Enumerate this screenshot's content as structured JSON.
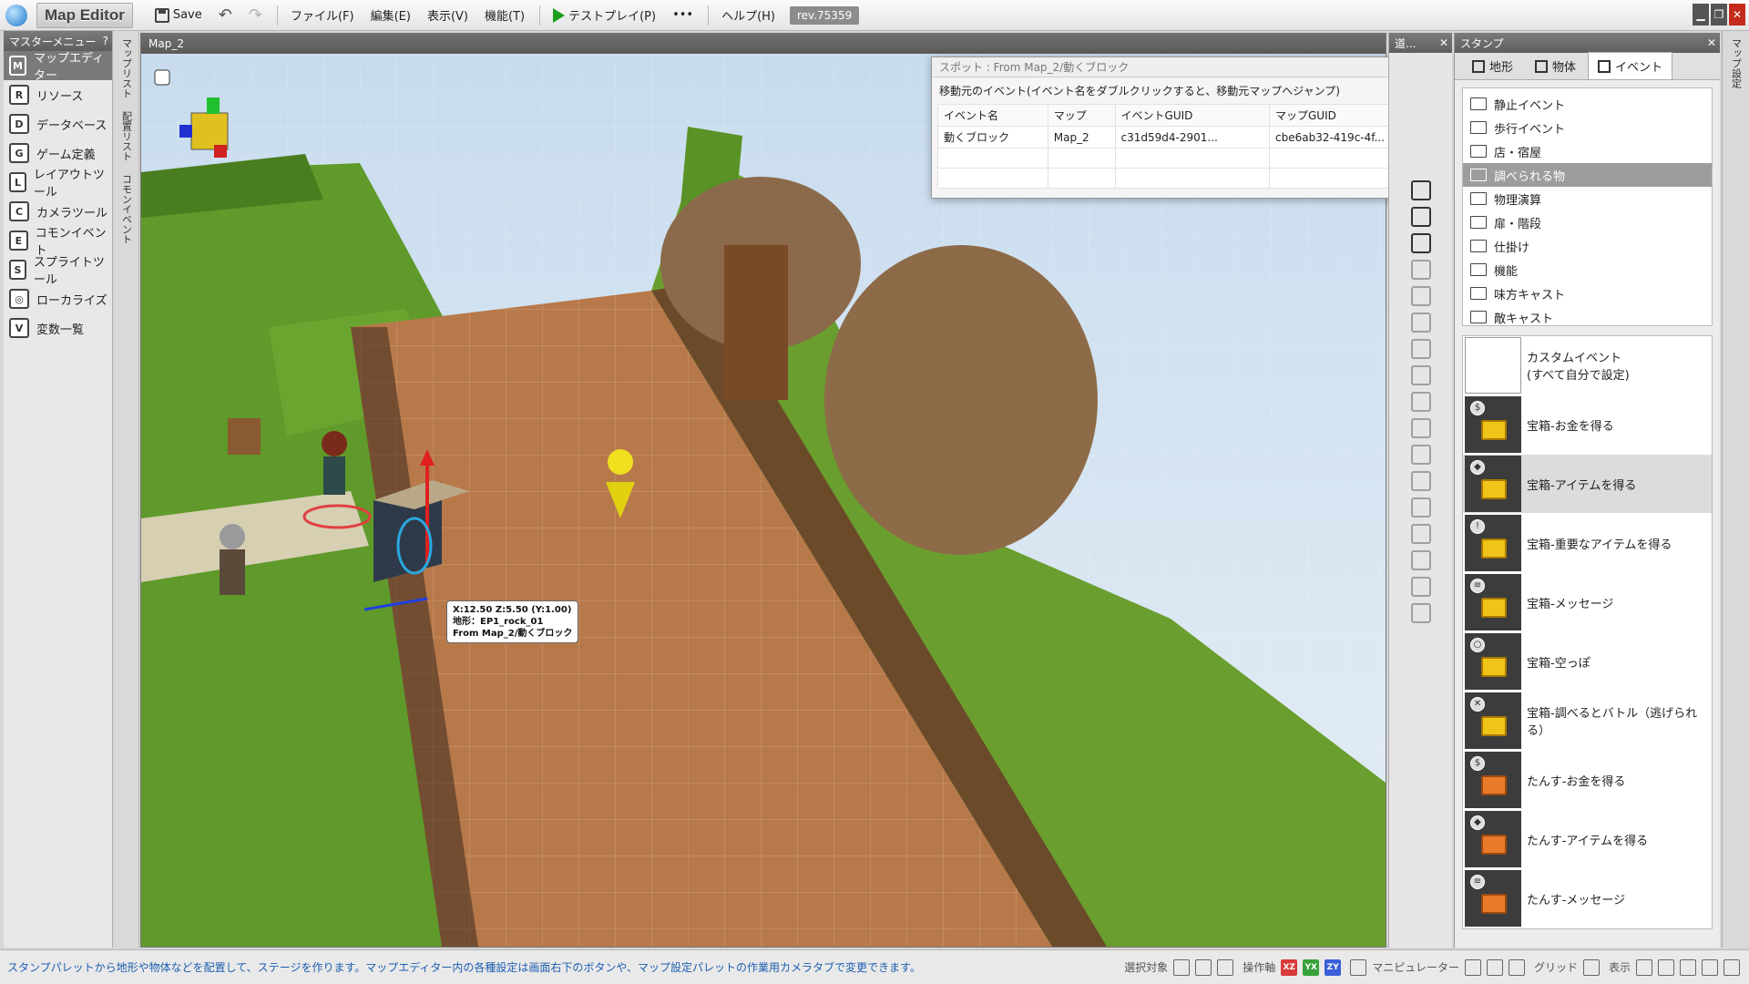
{
  "app": {
    "title": "Map Editor",
    "save_label": "Save",
    "menus": [
      "ファイル(F)",
      "編集(E)",
      "表示(V)",
      "機能(T)"
    ],
    "testplay_label": "テストプレイ(P)",
    "more_label": "•••",
    "help_label": "ヘルプ(H)",
    "revision": "rev.75359"
  },
  "master_menu": {
    "title": "マスターメニュー",
    "help": "?",
    "items": [
      {
        "label": "マップエディター",
        "icon": "map-editor-icon",
        "glyph": "M"
      },
      {
        "label": "リソース",
        "icon": "resource-icon",
        "glyph": "R"
      },
      {
        "label": "データベース",
        "icon": "database-icon",
        "glyph": "D"
      },
      {
        "label": "ゲーム定義",
        "icon": "game-definition-icon",
        "glyph": "G"
      },
      {
        "label": "レイアウトツール",
        "icon": "layout-tool-icon",
        "glyph": "L"
      },
      {
        "label": "カメラツール",
        "icon": "camera-tool-icon",
        "glyph": "C"
      },
      {
        "label": "コモンイベント",
        "icon": "common-event-icon",
        "glyph": "E"
      },
      {
        "label": "スプライトツール",
        "icon": "sprite-tool-icon",
        "glyph": "S"
      },
      {
        "label": "ローカライズ",
        "icon": "localize-icon",
        "glyph": "◎"
      },
      {
        "label": "変数一覧",
        "icon": "variable-list-icon",
        "glyph": "V"
      }
    ]
  },
  "side_tabs": {
    "left": [
      "マップリスト",
      "配置リスト",
      "コモンイベント"
    ],
    "right": [
      "マップ設定"
    ]
  },
  "viewport": {
    "title": "Map_2",
    "tooltip": [
      "X:12.50 Z:5.50 (Y:1.00)",
      "地形：EP1_rock_01",
      "From Map_2/動くブロック"
    ]
  },
  "spot_dialog": {
    "title": "スポット : From Map_2/動くブロック",
    "message": "移動元のイベント(イベント名をダブルクリックすると、移動元マップへジャンプ)",
    "columns": [
      "イベント名",
      "マップ",
      "イベントGUID",
      "マップGUID"
    ],
    "rows": [
      [
        "動くブロック",
        "Map_2",
        "c31d59d4-2901...",
        "cbe6ab32-419c-4f..."
      ]
    ]
  },
  "tool_column": {
    "title": "道..."
  },
  "stamp": {
    "title": "スタンプ",
    "tabs": [
      "地形",
      "物体",
      "イベント"
    ],
    "folders": [
      "静止イベント",
      "歩行イベント",
      "店・宿屋",
      "調べられる物",
      "物理演算",
      "扉・階段",
      "仕掛け",
      "機能",
      "味方キャスト",
      "敵キャスト"
    ],
    "selected_folder": 3,
    "events": [
      {
        "label": "カスタムイベント\n(すべて自分で設定)",
        "kind": "custom"
      },
      {
        "label": "宝箱-お金を得る",
        "kind": "chest",
        "badge": "$"
      },
      {
        "label": "宝箱-アイテムを得る",
        "kind": "chest",
        "badge": "◆",
        "selected": true
      },
      {
        "label": "宝箱-重要なアイテムを得る",
        "kind": "chest",
        "badge": "!"
      },
      {
        "label": "宝箱-メッセージ",
        "kind": "chest",
        "badge": "≡"
      },
      {
        "label": "宝箱-空っぽ",
        "kind": "chest",
        "badge": "○"
      },
      {
        "label": "宝箱-調べるとバトル（逃げられる）",
        "kind": "chest",
        "badge": "✕"
      },
      {
        "label": "たんす-お金を得る",
        "kind": "tansu",
        "badge": "$"
      },
      {
        "label": "たんす-アイテムを得る",
        "kind": "tansu",
        "badge": "◆"
      },
      {
        "label": "たんす-メッセージ",
        "kind": "tansu",
        "badge": "≡"
      }
    ]
  },
  "status": {
    "message": "スタンプパレットから地形や物体などを配置して、ステージを作ります。マップエディター内の各種設定は画面右下のボタンや、マップ設定パレットの作業用カメラタブで変更できます。",
    "select_target": "選択対象",
    "operation_axis": "操作軸",
    "axes": [
      "XZ",
      "YX",
      "ZY"
    ],
    "manipulator": "マニピュレーター",
    "grid": "グリッド",
    "display": "表示"
  },
  "colors": {
    "accent": "#1d5fb0",
    "grass": "#5f9a2a",
    "path": "#b87a4a",
    "sky": "#d8e6f2"
  }
}
